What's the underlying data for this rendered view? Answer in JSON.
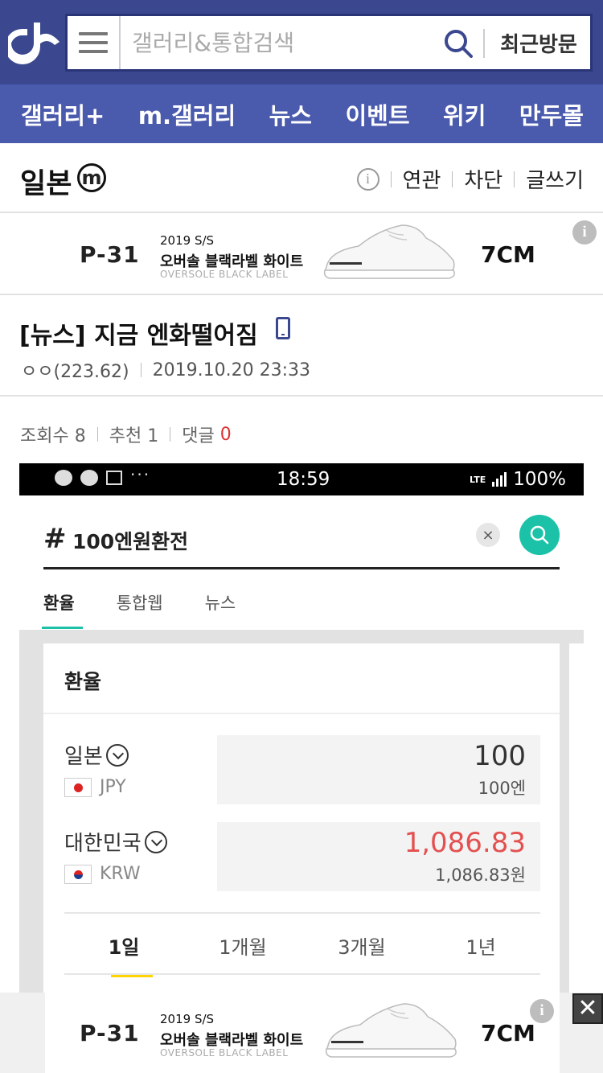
{
  "header": {
    "search_placeholder": "갤러리&통합검색",
    "recent_label": "최근방문",
    "nav": [
      "갤러리+",
      "m.갤러리",
      "뉴스",
      "이벤트",
      "위키",
      "만두몰"
    ]
  },
  "gallery": {
    "title": "일본",
    "badge": "m",
    "actions": [
      "연관",
      "차단",
      "글쓰기"
    ]
  },
  "ad": {
    "brand": "P-31",
    "year": "2019 S/S",
    "name": "오버솔 블랙라벨 화이트",
    "sub": "OVERSOLE BLACK LABEL",
    "size": "7CM",
    "info": "i",
    "close": "✕"
  },
  "post": {
    "title": "[뉴스] 지금 엔화떨어짐",
    "author": "ㅇㅇ(223.62)",
    "date": "2019.10.20 23:33",
    "views_label": "조회수 8",
    "recommend_label": "추천 1",
    "comments_label": "댓글",
    "comments_count": "0"
  },
  "embedded": {
    "time": "18:59",
    "battery": "100%",
    "lte": "LTE",
    "more": "···",
    "hash": "#",
    "query": "100엔원환전",
    "clear": "×",
    "tabs": [
      "환율",
      "통합웹",
      "뉴스"
    ],
    "card_title": "환율",
    "rows": [
      {
        "name": "일본",
        "code": "JPY",
        "amount": "100",
        "amount_sub": "100엔"
      },
      {
        "name": "대한민국",
        "code": "KRW",
        "amount": "1,086.83",
        "amount_sub": "1,086.83원"
      }
    ],
    "ranges": [
      "1일",
      "1개월",
      "3개월",
      "1년"
    ]
  },
  "colors": {
    "header_bg": "#3b4890",
    "nav_bg": "#4a5aac",
    "accent_green": "#1cc2a8",
    "krw_red": "#e45050",
    "range_yellow": "#ffd400"
  }
}
